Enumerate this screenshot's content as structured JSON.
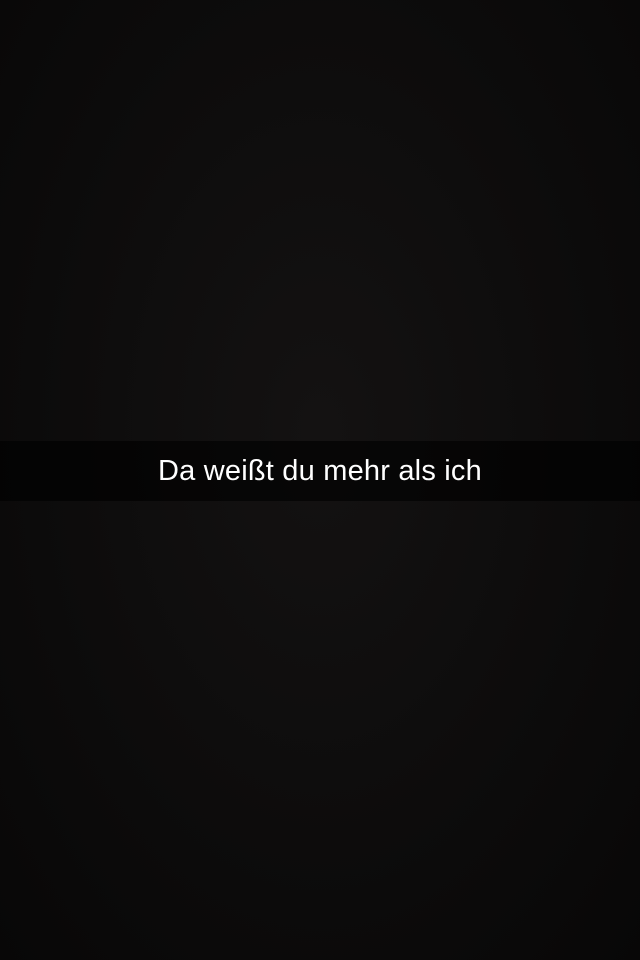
{
  "caption": {
    "text": "Da weißt du mehr als ich"
  }
}
